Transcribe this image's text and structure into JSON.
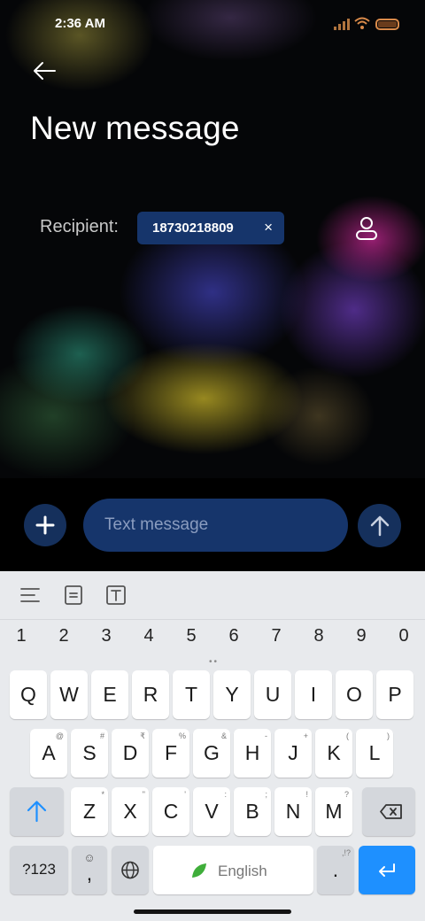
{
  "status_bar": {
    "time": "2:36 AM"
  },
  "header": {
    "title": "New message"
  },
  "recipient": {
    "label": "Recipient:",
    "number": "18730218809",
    "remove_symbol": "×"
  },
  "compose": {
    "placeholder": "Text message"
  },
  "keyboard": {
    "number_row": [
      "1",
      "2",
      "3",
      "4",
      "5",
      "6",
      "7",
      "8",
      "9",
      "0"
    ],
    "row1": [
      {
        "k": "Q"
      },
      {
        "k": "W"
      },
      {
        "k": "E"
      },
      {
        "k": "R"
      },
      {
        "k": "T"
      },
      {
        "k": "Y"
      },
      {
        "k": "U"
      },
      {
        "k": "I"
      },
      {
        "k": "O"
      },
      {
        "k": "P"
      }
    ],
    "row2": [
      {
        "k": "A",
        "h": "@"
      },
      {
        "k": "S",
        "h": "#"
      },
      {
        "k": "D",
        "h": "₹"
      },
      {
        "k": "F",
        "h": "%"
      },
      {
        "k": "G",
        "h": "&"
      },
      {
        "k": "H",
        "h": "-"
      },
      {
        "k": "J",
        "h": "+"
      },
      {
        "k": "K",
        "h": "("
      },
      {
        "k": "L",
        "h": ")"
      }
    ],
    "row3": [
      {
        "k": "Z",
        "h": "*"
      },
      {
        "k": "X",
        "h": "\""
      },
      {
        "k": "C",
        "h": "'"
      },
      {
        "k": "V",
        "h": ":"
      },
      {
        "k": "B",
        "h": ";"
      },
      {
        "k": "N",
        "h": "!"
      },
      {
        "k": "M",
        "h": "?"
      }
    ],
    "symbols_key": "?123",
    "comma_key": ",",
    "space_label": "English",
    "period_key": ".",
    "period_hint": ",!?"
  },
  "colors": {
    "accent": "#1e90ff",
    "chip": "#16356b",
    "round_button": "#15305c",
    "keyboard_bg": "#e8eaed"
  }
}
